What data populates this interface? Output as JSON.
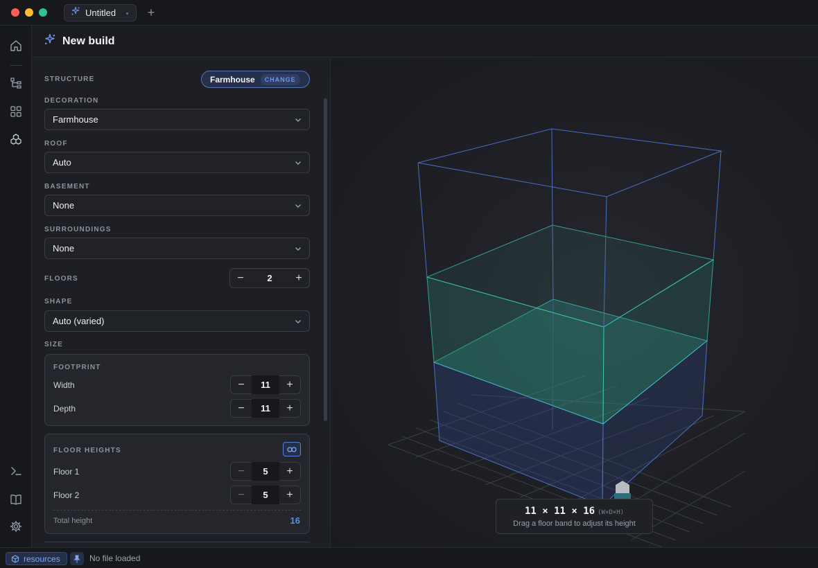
{
  "window": {
    "tab_label": "Untitled",
    "new_tab_symbol": "+"
  },
  "header": {
    "title": "New build",
    "icon": "sparkle-icon"
  },
  "rail": {
    "items": [
      "home-icon",
      "tree-icon",
      "grid-icon",
      "cubes-icon",
      "terminal-icon",
      "book-icon",
      "gear-icon"
    ]
  },
  "form": {
    "structure": {
      "label": "STRUCTURE",
      "value": "Farmhouse",
      "change_label": "CHANGE"
    },
    "decoration": {
      "label": "DECORATION",
      "value": "Farmhouse"
    },
    "roof": {
      "label": "ROOF",
      "value": "Auto"
    },
    "basement": {
      "label": "BASEMENT",
      "value": "None"
    },
    "surroundings": {
      "label": "SURROUNDINGS",
      "value": "None"
    },
    "floors": {
      "label": "FLOORS",
      "value": "2",
      "minus": "−",
      "plus": "+"
    },
    "shape": {
      "label": "SHAPE",
      "value": "Auto (varied)"
    },
    "size_label": "SIZE",
    "footprint": {
      "label": "FOOTPRINT",
      "width_label": "Width",
      "width_value": "11",
      "depth_label": "Depth",
      "depth_value": "11"
    },
    "floor_heights": {
      "label": "FLOOR HEIGHTS",
      "rows": [
        {
          "label": "Floor 1",
          "value": "5"
        },
        {
          "label": "Floor 2",
          "value": "5"
        }
      ],
      "total_label": "Total height",
      "total_value": "16"
    }
  },
  "viewport": {
    "dims": "11 × 11 × 16",
    "dims_unit": "(W×D×H)",
    "hint": "Drag a floor band to adjust its height"
  },
  "status": {
    "resources_label": "resources",
    "file_text": "No file loaded"
  },
  "colors": {
    "accent": "#5b8fe8",
    "floor_band": "#3fd1c0",
    "wireframe": "#4a6fc4"
  }
}
